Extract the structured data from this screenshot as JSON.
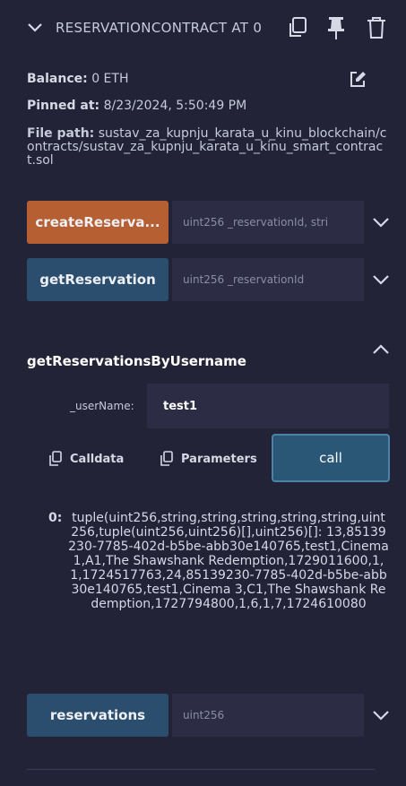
{
  "header": {
    "title": "RESERVATIONCONTRACT AT 0",
    "icons": [
      "chevron-down-icon",
      "copy-icon",
      "pin-icon",
      "trash-icon"
    ]
  },
  "info": {
    "balance_label": "Balance:",
    "balance_value": "0 ETH",
    "pinned_label": "Pinned at:",
    "pinned_value": "8/23/2024, 5:50:49 PM",
    "filepath_label": "File path:",
    "filepath_value": "sustav_za_kupnju_karata_u_kinu_blockchain/contracts/sustav_za_kupnju_karata_u_kinu_smart_contract.sol"
  },
  "functions": [
    {
      "label": "createReserva...",
      "placeholder": "uint256 _reservationId, stri",
      "color": "#b55f32"
    },
    {
      "label": "getReservation",
      "placeholder": "uint256 _reservationId",
      "color": "#2c4e6e"
    }
  ],
  "expanded": {
    "title": "getReservationsByUsername",
    "param_name": "_userName:",
    "param_value": "test1",
    "calldata_label": "Calldata",
    "parameters_label": "Parameters",
    "call_label": "call",
    "result_index": "0:",
    "result_value": "tuple(uint256,string,string,string,string,string,uint256,tuple(uint256,uint256)[],uint256)[]: 13,85139230-7785-402d-b5be-abb30e140765,test1,Cinema 1,A1,The Shawshank Redemption,1729011600,1,1,1724517763,24,85139230-7785-402d-b5be-abb30e140765,test1,Cinema 3,C1,The Shawshank Redemption,1727794800,1,6,1,7,1724610080"
  },
  "bottom_function": {
    "label": "reservations",
    "placeholder": "uint256",
    "color": "#2c4e6e"
  },
  "colors": {
    "background": "#222336",
    "orange": "#b55f32",
    "blue": "#2c4e6e",
    "call": "#2b5777"
  }
}
